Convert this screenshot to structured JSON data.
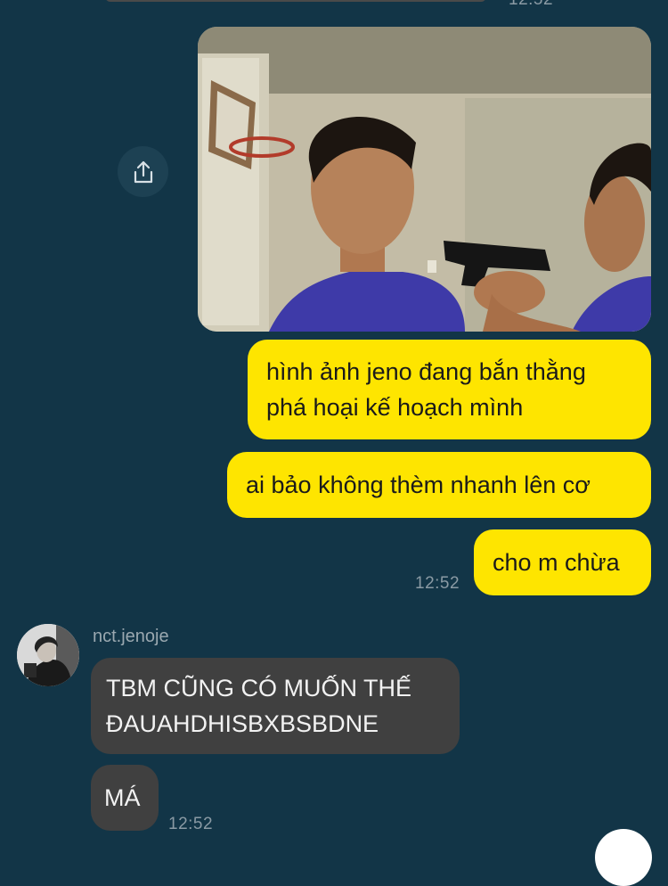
{
  "chat": {
    "top_time": "12:52",
    "outgoing": [
      "hình ảnh jeno đang bắn thằng",
      "phá hoại kế hoạch mình",
      "ai bảo không thèm nhanh lên cơ",
      "cho m chừa"
    ],
    "outgoing_time": "12:52",
    "sender_name": "nct.jenoje",
    "incoming": [
      "TBM CŨNG CÓ MUỐN THẾ",
      "ĐAUAHDHISBXBSBDNE",
      "MÁ"
    ],
    "incoming_time": "12:52"
  },
  "icons": {
    "share": "share-upload-icon"
  },
  "colors": {
    "background": "#123547",
    "outgoing_bubble": "#fee500",
    "incoming_bubble": "#404040",
    "timestamp": "#8a9aa4"
  }
}
